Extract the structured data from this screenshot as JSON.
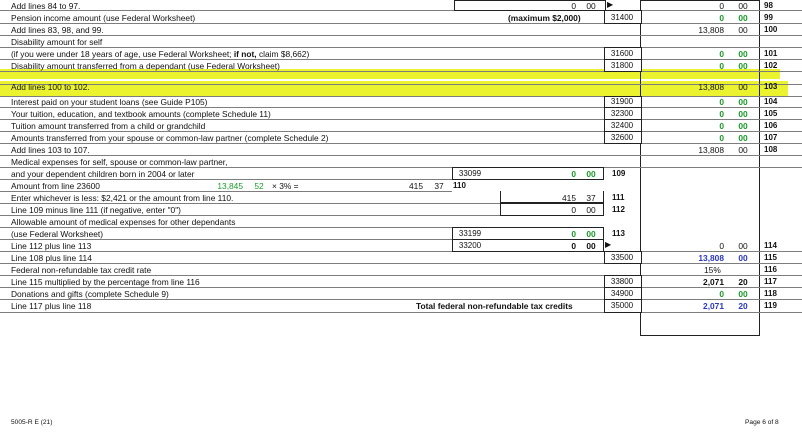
{
  "rows": {
    "r97": {
      "text": "Add lines 84 to 97.",
      "mid_amt": "0",
      "mid_cents": "00",
      "amt": "0",
      "cents": "00",
      "line": "98"
    },
    "r99": {
      "text": "Pension income amount (use Federal Worksheet)",
      "max": "(maximum $2,000)",
      "code": "31400",
      "amt": "0",
      "cents": "00",
      "line": "99"
    },
    "r100": {
      "text": "Add lines 83, 98, and 99.",
      "amt": "13,808",
      "cents": "00",
      "line": "100"
    },
    "r101a": {
      "text": "Disability amount for self"
    },
    "r101b": {
      "text_pre": "(if you were under 18 years of age, use Federal Worksheet; ",
      "text_bold": "if not,",
      "text_post": " claim $8,662)",
      "code": "31600",
      "amt": "0",
      "cents": "00",
      "line": "101"
    },
    "r102": {
      "text": "Disability amount transferred from a dependant (use Federal Worksheet)",
      "code": "31800",
      "amt": "0",
      "cents": "00",
      "line": "102"
    },
    "r103": {
      "text": "Add lines 100 to 102.",
      "amt": "13,808",
      "cents": "00",
      "line": "103"
    },
    "r104": {
      "text": "Interest paid on your student loans (see Guide P105)",
      "code": "31900",
      "amt": "0",
      "cents": "00",
      "line": "104"
    },
    "r105": {
      "text": "Your tuition, education, and textbook amounts (complete Schedule 11)",
      "code": "32300",
      "amt": "0",
      "cents": "00",
      "line": "105"
    },
    "r106": {
      "text": "Tuition amount transferred from a child or grandchild",
      "code": "32400",
      "amt": "0",
      "cents": "00",
      "line": "106"
    },
    "r107": {
      "text": "Amounts transferred from your spouse or common-law partner (complete Schedule 2)",
      "code": "32600",
      "amt": "0",
      "cents": "00",
      "line": "107"
    },
    "r108": {
      "text": "Add lines 103 to 107.",
      "amt": "13,808",
      "cents": "00",
      "line": "108"
    },
    "r109a": {
      "text": "Medical expenses for self, spouse or common-law partner,"
    },
    "r109b": {
      "text": "and your dependent children born in 2004 or later",
      "code": "33099",
      "amt": "0",
      "cents": "00",
      "line": "109"
    },
    "r110": {
      "text": "Amount from line 23600",
      "net": "13,845",
      "net_cents": "52",
      "mult": "× 3% =",
      "res": "415",
      "res_cents": "37",
      "line": "110"
    },
    "r111": {
      "text": "Enter whichever is less: $2,421 or the amount from line 110.",
      "amt": "415",
      "cents": "37",
      "line": "111"
    },
    "r112": {
      "text": "Line 109 minus line 111 (if negative, enter \"0\")",
      "amt": "0",
      "cents": "00",
      "line": "112"
    },
    "r113a": {
      "text": "Allowable amount of medical expenses for other dependants"
    },
    "r113b": {
      "text": "(use Federal Worksheet)",
      "code": "33199",
      "amt": "0",
      "cents": "00",
      "line": "113"
    },
    "r114": {
      "text": "Line 112 plus line 113",
      "code": "33200",
      "mid_amt": "0",
      "mid_cents": "00",
      "amt": "0",
      "cents": "00",
      "line": "114"
    },
    "r115": {
      "text": "Line 108 plus line 114",
      "code": "33500",
      "amt": "13,808",
      "cents": "00",
      "line": "115"
    },
    "r116": {
      "text": "Federal non-refundable tax credit rate",
      "rate": "15%",
      "line": "116"
    },
    "r117": {
      "text": "Line 115 multiplied by the percentage from line 116",
      "code": "33800",
      "amt": "2,071",
      "cents": "20",
      "line": "117"
    },
    "r118": {
      "text": "Donations and gifts (complete Schedule 9)",
      "code": "34900",
      "amt": "0",
      "cents": "00",
      "line": "118"
    },
    "r119": {
      "text": "Line 117 plus line 118",
      "total_label": "Total federal non-refundable tax credits",
      "code": "35000",
      "amt": "2,071",
      "cents": "20",
      "line": "119"
    }
  },
  "footer": {
    "form": "5005-R E (21)",
    "page": "Page 6 of 8"
  },
  "colors": {
    "highlight": "#e6f000",
    "green": "#1b9a2a",
    "blue": "#2a36c0"
  }
}
